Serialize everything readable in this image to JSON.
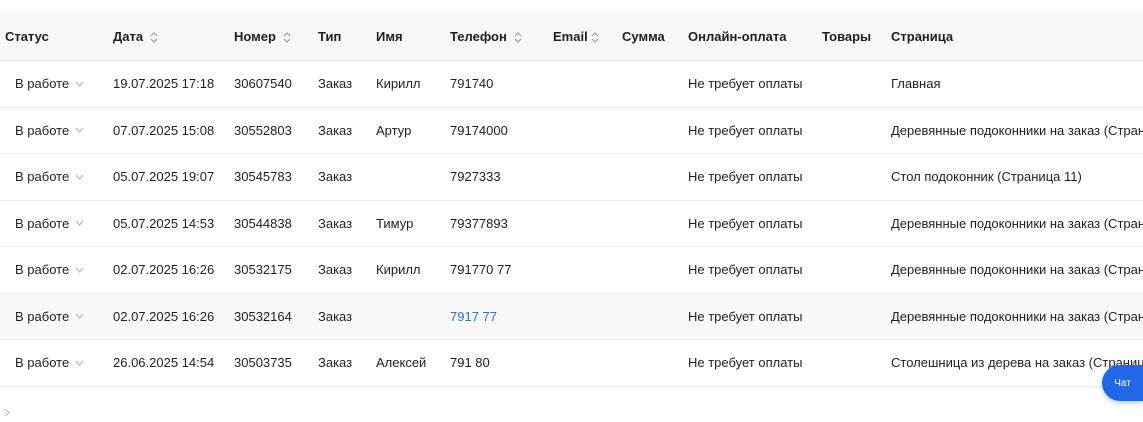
{
  "table": {
    "headers": [
      {
        "key": "status",
        "label": "Статус",
        "sortable": false
      },
      {
        "key": "date",
        "label": "Дата",
        "sortable": true
      },
      {
        "key": "number",
        "label": "Номер",
        "sortable": true
      },
      {
        "key": "type",
        "label": "Тип",
        "sortable": false
      },
      {
        "key": "name",
        "label": "Имя",
        "sortable": false
      },
      {
        "key": "phone",
        "label": "Телефон",
        "sortable": true
      },
      {
        "key": "email",
        "label": "Email",
        "sortable": true
      },
      {
        "key": "sum",
        "label": "Сумма",
        "sortable": false
      },
      {
        "key": "payment",
        "label": "Онлайн-оплата",
        "sortable": false
      },
      {
        "key": "goods",
        "label": "Товары",
        "sortable": false
      },
      {
        "key": "page",
        "label": "Страница",
        "sortable": false
      }
    ],
    "rows": [
      {
        "status": "В работе",
        "date": "19.07.2025 17:18",
        "number": "30607540",
        "type": "Заказ",
        "name": "Кирилл",
        "phone": "791740",
        "email": "",
        "sum": "",
        "payment": "Не требует оплаты",
        "goods": "",
        "page": "Главная"
      },
      {
        "status": "В работе",
        "date": "07.07.2025 15:08",
        "number": "30552803",
        "type": "Заказ",
        "name": "Артур",
        "phone": "79174000",
        "email": "",
        "sum": "",
        "payment": "Не требует оплаты",
        "goods": "",
        "page": "Деревянные подоконники на заказ (Страница"
      },
      {
        "status": "В работе",
        "date": "05.07.2025 19:07",
        "number": "30545783",
        "type": "Заказ",
        "name": "",
        "phone": "7927333",
        "email": "",
        "sum": "",
        "payment": "Не требует оплаты",
        "goods": "",
        "page": "Стол подоконник (Страница 11)"
      },
      {
        "status": "В работе",
        "date": "05.07.2025 14:53",
        "number": "30544838",
        "type": "Заказ",
        "name": "Тимур",
        "phone": "79377893",
        "email": "",
        "sum": "",
        "payment": "Не требует оплаты",
        "goods": "",
        "page": "Деревянные подоконники на заказ (Страница"
      },
      {
        "status": "В работе",
        "date": "02.07.2025 16:26",
        "number": "30532175",
        "type": "Заказ",
        "name": "Кирилл",
        "phone": "791770  77",
        "email": "",
        "sum": "",
        "payment": "Не требует оплаты",
        "goods": "",
        "page": "Деревянные подоконники на заказ (Страница"
      },
      {
        "status": "В работе",
        "date": "02.07.2025 16:26",
        "number": "30532164",
        "type": "Заказ",
        "name": "",
        "phone": "7917   77",
        "email": "",
        "sum": "",
        "payment": "Не требует оплаты",
        "goods": "",
        "page": "Деревянные подоконники на заказ (Страница",
        "phone_link": true,
        "highlighted": true
      },
      {
        "status": "В работе",
        "date": "26.06.2025 14:54",
        "number": "30503735",
        "type": "Заказ",
        "name": "Алексей",
        "phone": "791   80",
        "email": "",
        "sum": "",
        "payment": "Не требует оплаты",
        "goods": "",
        "page": "Столешница из дерева на заказ (Страница"
      }
    ]
  },
  "icons": {
    "sort": "sort-arrows-icon",
    "status_dropdown": "chevron-down-icon",
    "pager": "chevron-right-icon"
  },
  "chat": {
    "label": "Чат"
  },
  "colors": {
    "header_bg": "#f6f7f8",
    "link": "#2f6fd6",
    "chat_bg": "#2267e6",
    "border": "#eceef1"
  }
}
